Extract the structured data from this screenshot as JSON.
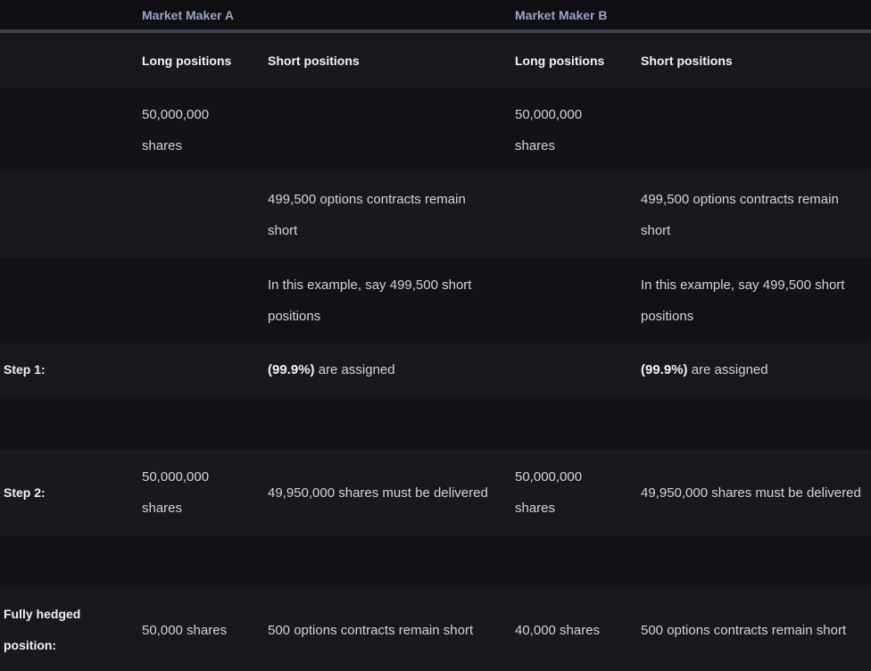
{
  "header": {
    "market_maker_a": "Market Maker A",
    "market_maker_b": "Market Maker B"
  },
  "subheader": {
    "a_long": "Long positions",
    "a_short": "Short positions",
    "b_long": "Long positions",
    "b_short": "Short positions"
  },
  "rows": {
    "initial": {
      "label": "",
      "a_long": "50,000,000 shares",
      "a_short": "",
      "b_long": "50,000,000 shares",
      "b_short": ""
    },
    "contracts_remain": {
      "a_short": "499,500 options contracts remain short",
      "b_short": "499,500 options contracts remain short"
    },
    "example": {
      "a_short": "In this example, say 499,500 short positions",
      "b_short": "In this example, say 499,500 short positions"
    },
    "step1": {
      "label": "Step 1:",
      "a_short_pct": "(99.9%)",
      "a_short_rest": " are assigned",
      "b_short_pct": "(99.9%)",
      "b_short_rest": " are assigned"
    },
    "step2": {
      "label": "Step 2:",
      "a_long": "50,000,000 shares",
      "a_short": "49,950,000 shares must be delivered",
      "b_long": "50,000,000 shares",
      "b_short": "49,950,000 shares must be delivered"
    },
    "hedged": {
      "label": "Fully hedged position:",
      "a_long": "50,000 shares",
      "a_short": "500 options contracts remain short",
      "b_long": "40,000 shares",
      "b_short": "500 options contracts remain short"
    }
  }
}
